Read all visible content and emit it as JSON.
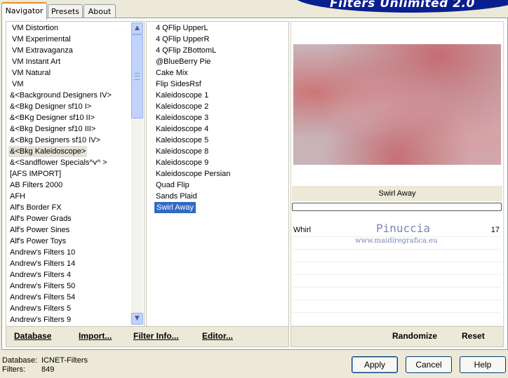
{
  "tabs": [
    {
      "label": "Navigator",
      "active": true
    },
    {
      "label": "Presets",
      "active": false
    },
    {
      "label": "About",
      "active": false
    }
  ],
  "banner_title": "Filters Unlimited 2.0",
  "categories": [
    "VM Distortion",
    "VM Experimental",
    "VM Extravaganza",
    "VM Instant Art",
    "VM Natural",
    "VM",
    "&<Background Designers IV>",
    "&<Bkg Designer sf10 I>",
    "&<BKg Designer sf10 II>",
    "&<Bkg Designer sf10 III>",
    "&<Bkg Designers sf10 IV>",
    "&<Bkg Kaleidoscope>",
    "&<Sandflower Specials^v^ >",
    "[AFS IMPORT]",
    "AB Filters 2000",
    "AFH",
    "Alf's Border FX",
    "Alf's Power Grads",
    "Alf's Power Sines",
    "Alf's Power Toys",
    "Andrew's Filters 10",
    "Andrew's Filters 14",
    "Andrew's Filters 4",
    "Andrew's Filters 50",
    "Andrew's Filters 54",
    "Andrew's Filters 5",
    "Andrew's Filters 9"
  ],
  "selected_category": "&<Bkg Kaleidoscope>",
  "filters": [
    "4 QFlip UpperL",
    "4 QFlip UpperR",
    "4 QFlip ZBottomL",
    "@BlueBerry Pie",
    "Cake Mix",
    "Flip SidesRsf",
    "Kaleidoscope 1",
    "Kaleidoscope 2",
    "Kaleidoscope 3",
    "Kaleidoscope 4",
    "Kaleidoscope 5",
    "Kaleidoscope 8",
    "Kaleidoscope 9",
    "Kaleidoscope Persian",
    "Quad Flip",
    "Sands Plaid",
    "Swirl Away"
  ],
  "selected_filter": "Swirl Away",
  "filter_name_label": "Swirl Away",
  "params": [
    {
      "name": "Whirl",
      "value": "17"
    }
  ],
  "watermark": {
    "line1": "Pinuccia",
    "line2": "www.maidiregrafica.eu"
  },
  "left_buttons": {
    "database": "Database",
    "import": "Import...",
    "filter_info": "Filter Info...",
    "editor": "Editor..."
  },
  "right_buttons": {
    "randomize": "Randomize",
    "reset": "Reset"
  },
  "status": {
    "database_label": "Database:",
    "database_value": "ICNET-Filters",
    "filters_label": "Filters:",
    "filters_value": "849"
  },
  "dialog_buttons": {
    "apply": "Apply",
    "cancel": "Cancel",
    "help": "Help"
  },
  "colors": {
    "selection": "#316ac5",
    "banner": "#0a1f8f",
    "face": "#ece9d8"
  }
}
